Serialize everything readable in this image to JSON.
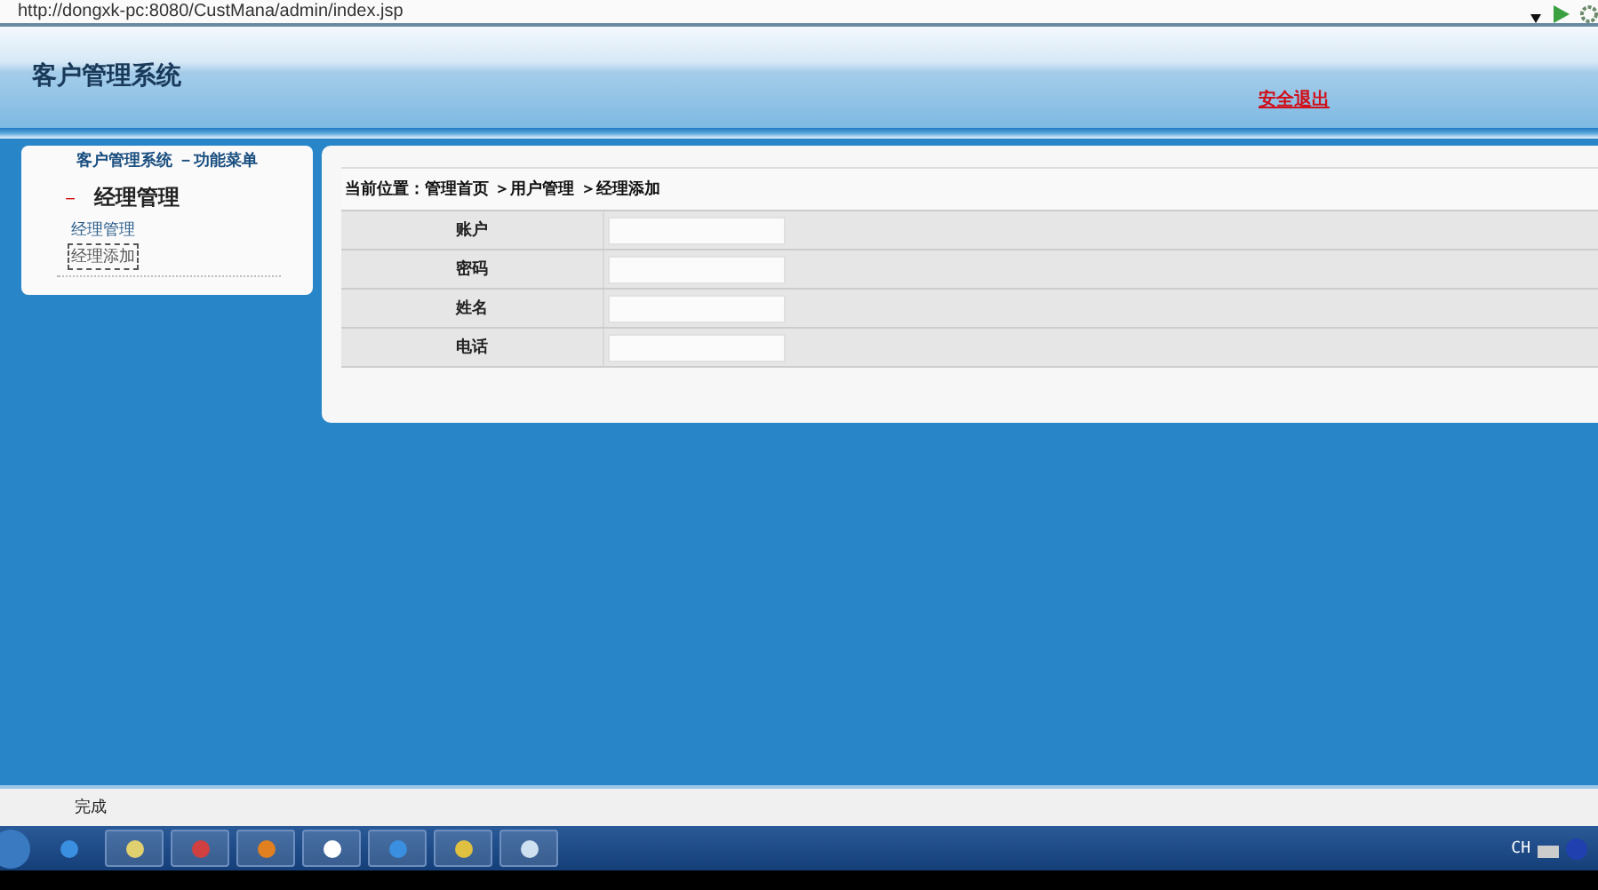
{
  "address_bar": {
    "url": "http://dongxk-pc:8080/CustMana/admin/index.jsp"
  },
  "header": {
    "title": "客户管理系统",
    "logout_link": "安全退出"
  },
  "sidebar": {
    "title": "客户管理系统 －功能菜单",
    "section": {
      "marker": "－",
      "label": "经理管理",
      "expanded": true
    },
    "items": [
      {
        "label": "经理管理",
        "selected": false
      },
      {
        "label": "经理添加",
        "selected": true
      }
    ]
  },
  "breadcrumb": "当前位置：管理首页 ＞用户管理 ＞经理添加",
  "form": {
    "rows": [
      {
        "label": "账户"
      },
      {
        "label": "密码"
      },
      {
        "label": "姓名"
      },
      {
        "label": "电话"
      }
    ]
  },
  "status_bar": {
    "text": "完成"
  },
  "taskbar": {
    "language": "CH"
  }
}
